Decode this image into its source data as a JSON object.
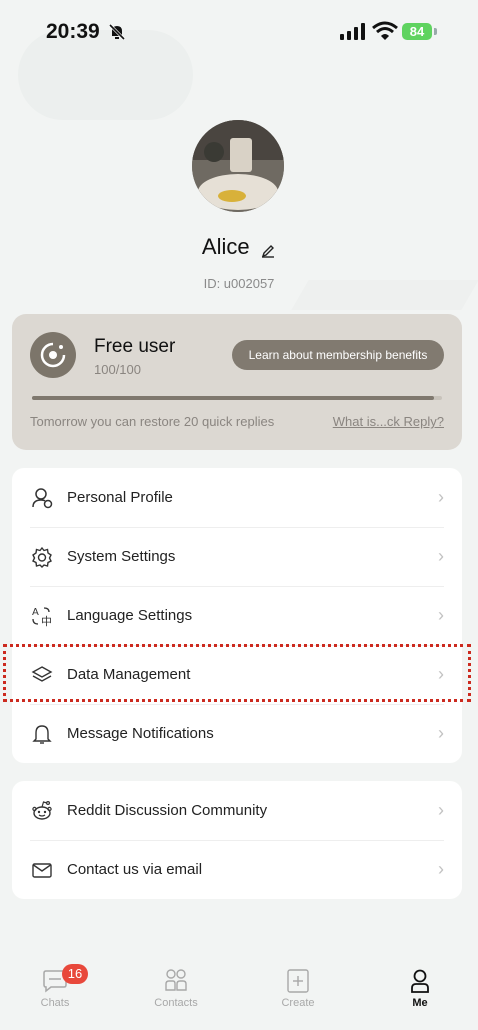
{
  "status_bar": {
    "time": "20:39",
    "battery": "84"
  },
  "profile": {
    "name": "Alice",
    "id_text": "ID: u002057"
  },
  "membership": {
    "title": "Free user",
    "quota": "100/100",
    "quota_fraction": 0.98,
    "benefits_button": "Learn about membership benefits",
    "restore_text": "Tomorrow you can restore 20 quick replies",
    "what_link": "What is...ck Reply?"
  },
  "menu_group_1": [
    {
      "label": "Personal Profile",
      "icon": "person-icon"
    },
    {
      "label": "System Settings",
      "icon": "gear-icon"
    },
    {
      "label": "Language Settings",
      "icon": "translate-icon"
    },
    {
      "label": "Data Management",
      "icon": "layers-icon"
    },
    {
      "label": "Message Notifications",
      "icon": "bell-icon"
    }
  ],
  "menu_group_2": [
    {
      "label": "Reddit Discussion Community",
      "icon": "reddit-icon"
    },
    {
      "label": "Contact us via email",
      "icon": "mail-icon"
    }
  ],
  "tabbar": {
    "chats": "Chats",
    "chats_badge": "16",
    "contacts": "Contacts",
    "create": "Create",
    "me": "Me"
  },
  "colors": {
    "accent_badge": "#e8483b",
    "highlight": "#cc2a1f",
    "card": "#dcd8d2"
  }
}
